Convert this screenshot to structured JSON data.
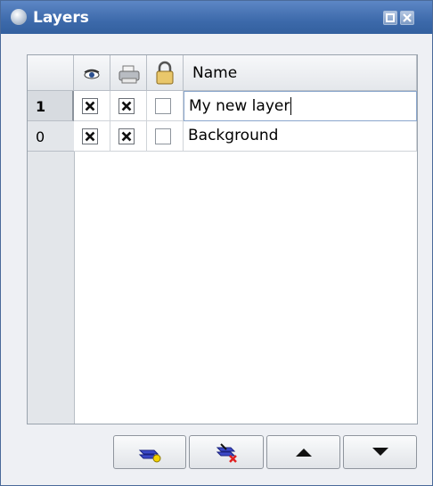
{
  "window": {
    "title": "Layers",
    "title_icon": "layers-globe-icon",
    "controls": [
      "restore-icon",
      "close-icon"
    ],
    "accent_color": "#3d6aab"
  },
  "table": {
    "headers": {
      "visible": "eye-icon",
      "printable": "printer-icon",
      "locked": "padlock-icon",
      "name": "Name"
    },
    "rows": [
      {
        "number": "1",
        "visible": true,
        "printable": true,
        "locked": false,
        "name": "My new layer",
        "active": true,
        "editing": true
      },
      {
        "number": "0",
        "visible": true,
        "printable": true,
        "locked": false,
        "name": "Background",
        "active": false,
        "editing": false
      }
    ]
  },
  "buttons": [
    {
      "name": "add-layer-button",
      "icon": "add-layer-icon"
    },
    {
      "name": "delete-layer-button",
      "icon": "delete-layer-icon"
    },
    {
      "name": "raise-layer-button",
      "icon": "up-arrow-icon"
    },
    {
      "name": "lower-layer-button",
      "icon": "down-arrow-icon"
    }
  ]
}
